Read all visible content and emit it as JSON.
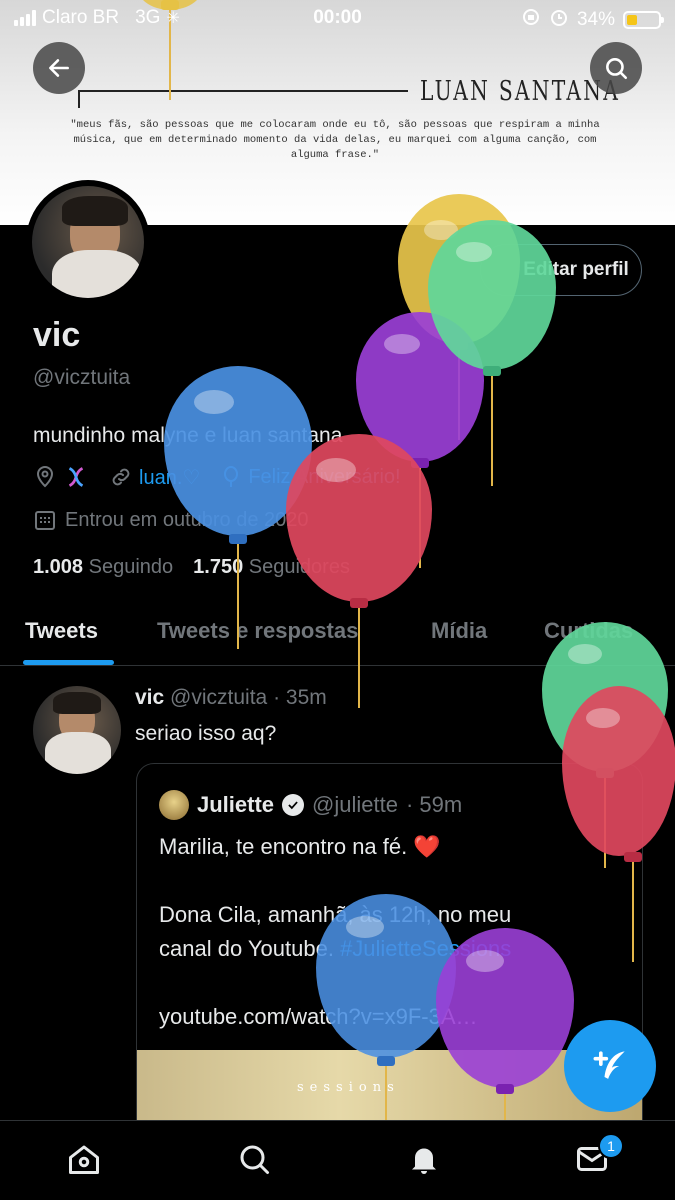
{
  "status_bar": {
    "carrier": "Claro BR",
    "network": "3G",
    "time": "00:00",
    "battery_percent": "34%"
  },
  "banner": {
    "title": "LUAN SANTANA",
    "quote": "\"meus fãs, são pessoas que me colocaram onde eu tô, são pessoas que respiram a minha música, que em determinado momento da vida delas, eu marquei com alguma canção, com alguma frase.\""
  },
  "profile": {
    "edit_button": "Editar perfil",
    "name": "vic",
    "handle": "@vicztuita",
    "bio": "mundinho malyne e luan santana",
    "link_text": "luan.♡",
    "birthday_text": "Feliz Aniversário!",
    "joined": "Entrou em outubro de 2020",
    "following_count": "1.008",
    "following_label": "Seguindo",
    "followers_count": "1.750",
    "followers_label": "Seguidores"
  },
  "tabs": [
    {
      "label": "Tweets",
      "active": true
    },
    {
      "label": "Tweets e respostas",
      "active": false
    },
    {
      "label": "Mídia",
      "active": false
    },
    {
      "label": "Curtidas",
      "active": false
    }
  ],
  "tweet": {
    "author_name": "vic",
    "author_handle": "@vicztuita",
    "time": "· 35m",
    "text": "seriao isso aq?",
    "quote": {
      "author_name": "Juliette",
      "author_handle": "@juliette",
      "time": "· 59m",
      "line1": "Marilia, te encontro na fé. ❤️",
      "line2": "Dona Cila, amanhã, às 12h, no meu",
      "line3_plain": "canal do Youtube. ",
      "line3_hashtag": "#JulietteSessions",
      "line4": "youtube.com/watch?v=x9F-3A…",
      "media_text": "sessions"
    }
  },
  "bottom_nav": {
    "messages_badge": "1"
  },
  "icons": {
    "back": "back-arrow-icon",
    "search": "search-icon",
    "location": "location-pin-icon",
    "dna": "dna-emoji-icon",
    "link": "link-icon",
    "balloon": "balloon-icon",
    "calendar": "calendar-icon",
    "verified": "verified-badge-icon",
    "compose": "compose-tweet-icon",
    "home": "home-icon",
    "notifications": "bell-icon",
    "messages": "envelope-icon"
  },
  "colors": {
    "accent": "#1d9bf0",
    "background": "#000000",
    "text_primary": "#e7e9ea",
    "text_secondary": "#71767b"
  }
}
